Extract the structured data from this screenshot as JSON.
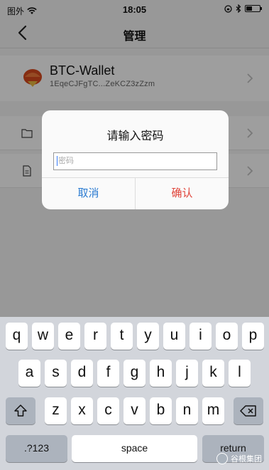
{
  "status_bar": {
    "carrier": "图外",
    "time": "18:05"
  },
  "nav": {
    "title": "管理"
  },
  "wallet": {
    "name": "BTC-Wallet",
    "address": "1EqeCJFgTC...ZeKCZ3zZzm"
  },
  "dialog": {
    "title": "请输入密码",
    "placeholder": "密码",
    "cancel": "取消",
    "confirm": "确认"
  },
  "keyboard": {
    "row1": [
      "q",
      "w",
      "e",
      "r",
      "t",
      "y",
      "u",
      "i",
      "o",
      "p"
    ],
    "row2": [
      "a",
      "s",
      "d",
      "f",
      "g",
      "h",
      "j",
      "k",
      "l"
    ],
    "row3": [
      "z",
      "x",
      "c",
      "v",
      "b",
      "n",
      "m"
    ],
    "numbers_label": ".?123",
    "space_label": "space",
    "return_label": "return"
  },
  "watermark": {
    "text": "谷根集团"
  },
  "colors": {
    "cancel": "#2b7bd1",
    "confirm": "#e0443a",
    "keyboard_bg": "#d2d5db"
  }
}
